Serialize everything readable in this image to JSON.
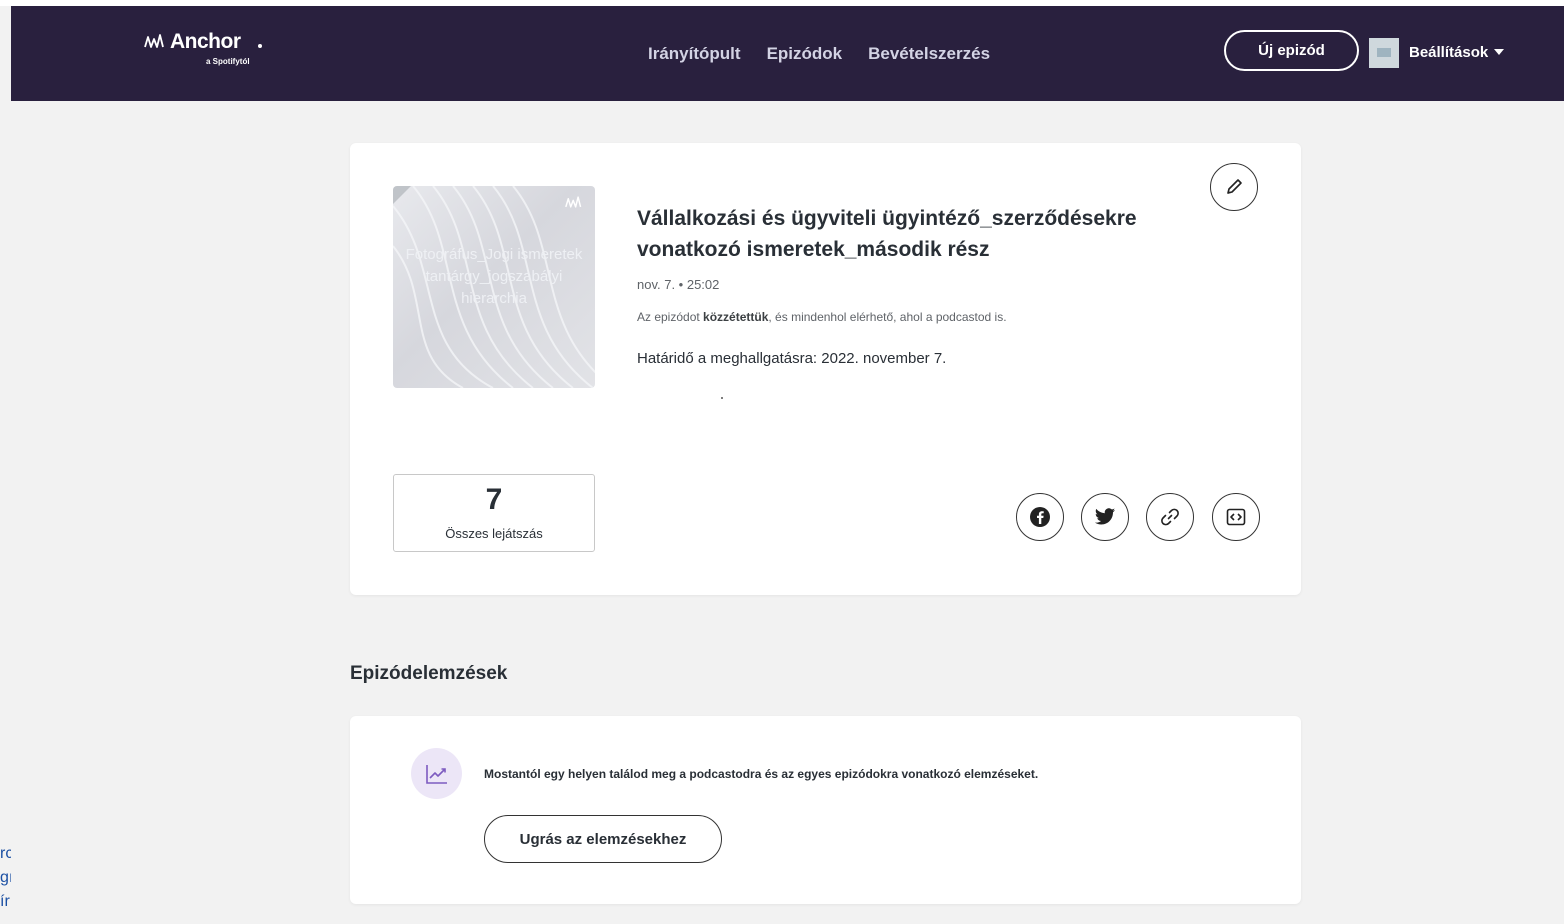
{
  "brand": {
    "name": "Anchor",
    "subtitle": "a Spotifytól"
  },
  "nav": {
    "links": [
      "Irányítópult",
      "Epizódok",
      "Bevételszerzés"
    ],
    "new_episode_label": "Új epizód",
    "settings_label": "Beállítások"
  },
  "episode": {
    "cover_text": "Fotográfus_Jogi ismeretek tantárgy_jogszabályi hierarchia",
    "title": "Vállalkozási és ügyviteli ügyintéző_szerződésekre vonatkozó ismeretek_második rész",
    "meta": "nov. 7. • 25:02",
    "status_prefix": "Az epizódot ",
    "status_bold": "közzétettük",
    "status_suffix": ", és mindenhol elérhető, ahol a podcastod is.",
    "deadline": "Határidő a meghallgatásra: 2022. november 7.",
    "plays_count": "7",
    "plays_label": "Összes lejátszás"
  },
  "analytics": {
    "section_title": "Epizódelemzések",
    "description": "Mostantól egy helyen találod meg a podcastodra és az egyes epizódokra vonatkozó elemzéseket.",
    "button_label": "Ugrás az elemzésekhez"
  },
  "clipped_left_text": [
    "rc",
    "gı",
    "ír"
  ],
  "colors": {
    "navbar": "#29203e",
    "nav_link": "#d3d3e4",
    "page_bg": "#f2f2f2",
    "analytics_icon_bg": "#ece6f7",
    "analytics_icon": "#7d5bc0"
  }
}
